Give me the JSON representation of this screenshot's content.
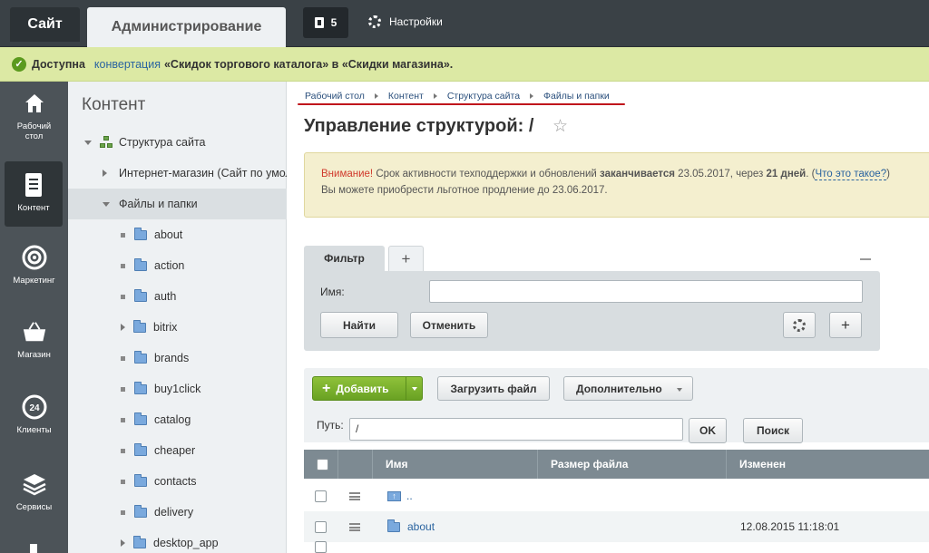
{
  "topbar": {
    "site_tab": "Сайт",
    "admin_tab": "Администрирование",
    "notifications_count": "5",
    "settings_label": "Настройки"
  },
  "notice": {
    "prefix": "Доступна",
    "link": "конвертация",
    "text": "«Скидок торгового каталога» в «Скидки магазина»."
  },
  "left_menu": [
    {
      "label": "Рабочий стол",
      "icon": "home-icon"
    },
    {
      "label": "Контент",
      "icon": "document-icon"
    },
    {
      "label": "Маркетинг",
      "icon": "target-icon"
    },
    {
      "label": "Магазин",
      "icon": "basket-icon"
    },
    {
      "label": "Клиенты",
      "icon": "clock-24-icon"
    },
    {
      "label": "Сервисы",
      "icon": "layers-icon"
    }
  ],
  "tree": {
    "title": "Контент",
    "root": "Структура сайта",
    "shop": "Интернет-магазин (Сайт по умол",
    "files": "Файлы и папки",
    "folders": [
      "about",
      "action",
      "auth",
      "bitrix",
      "brands",
      "buy1click",
      "catalog",
      "cheaper",
      "contacts",
      "delivery",
      "desktop_app"
    ]
  },
  "breadcrumbs": [
    "Рабочий стол",
    "Контент",
    "Структура сайта",
    "Файлы и папки"
  ],
  "page": {
    "title": "Управление структурой: /"
  },
  "warning": {
    "attention": "Внимание!",
    "text1": " Срок активности техподдержки и обновлений ",
    "bold1": "заканчивается",
    "text2": " 23.05.2017, через ",
    "bold2": "21 дней",
    "text3": ". (",
    "link": "Что это такое?",
    "text4": ")",
    "line2": "Вы можете приобрести льготное продление до 23.06.2017."
  },
  "filter": {
    "tab": "Фильтр",
    "add": "+",
    "name_label": "Имя:",
    "name_value": "",
    "find_button": "Найти",
    "cancel_button": "Отменить"
  },
  "toolbar": {
    "add_button": "Добавить",
    "upload_button": "Загрузить файл",
    "more_button": "Дополнительно"
  },
  "pathbar": {
    "label": "Путь:",
    "value": "/",
    "ok_button": "OK",
    "search_button": "Поиск"
  },
  "grid": {
    "columns": [
      "Имя",
      "Размер файла",
      "Изменен"
    ],
    "rows": [
      {
        "name": "..",
        "size": "",
        "modified": ""
      },
      {
        "name": "about",
        "size": "",
        "modified": "12.08.2015 11:18:01"
      }
    ]
  },
  "colors": {
    "topbar": "#3a4146",
    "notice": "#dce9a4",
    "accent_green": "#69a123",
    "link": "#2a64a0",
    "breadcrumb_underline": "#c0161c"
  }
}
